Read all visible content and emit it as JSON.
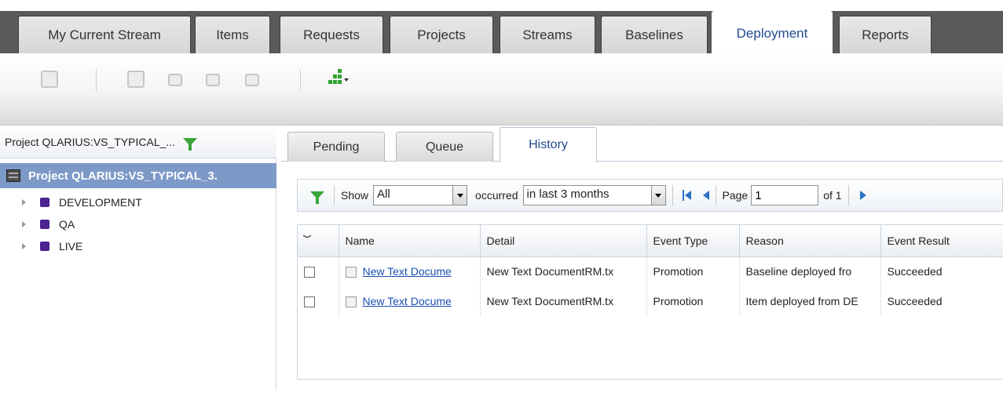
{
  "top_tabs": [
    {
      "label": "My Current Stream",
      "active": false
    },
    {
      "label": "Items",
      "active": false
    },
    {
      "label": "Requests",
      "active": false
    },
    {
      "label": "Projects",
      "active": false
    },
    {
      "label": "Streams",
      "active": false
    },
    {
      "label": "Baselines",
      "active": false
    },
    {
      "label": "Deployment",
      "active": true
    },
    {
      "label": "Reports",
      "active": false
    }
  ],
  "toolbar": {
    "icons": [
      "import-icon",
      "promote-icon",
      "demote-icon",
      "deploy-icon",
      "rollback-icon",
      "chart-icon"
    ]
  },
  "left_panel": {
    "header": "Project QLARIUS:VS_TYPICAL_...",
    "tree_root": "Project QLARIUS:VS_TYPICAL_3.",
    "nodes": [
      {
        "label": "DEVELOPMENT"
      },
      {
        "label": "QA"
      },
      {
        "label": "LIVE"
      }
    ]
  },
  "sub_tabs": [
    {
      "label": "Pending",
      "active": false
    },
    {
      "label": "Queue",
      "active": false
    },
    {
      "label": "History",
      "active": true
    }
  ],
  "filter_bar": {
    "show_label": "Show",
    "show_value": "All",
    "occurred_label": "occurred",
    "occurred_value": "in last 3 months",
    "page_label": "Page",
    "page_value": "1",
    "of_label": "of 1"
  },
  "table": {
    "columns": [
      "Name",
      "Detail",
      "Event Type",
      "Reason",
      "Event Result"
    ],
    "rows": [
      {
        "name": "New Text Docume",
        "detail": "New Text DocumentRM.tx",
        "event_type": "Promotion",
        "reason": "Baseline deployed fro",
        "result": "Succeeded"
      },
      {
        "name": "New Text Docume",
        "detail": "New Text DocumentRM.tx",
        "event_type": "Promotion",
        "reason": "Item deployed from DE",
        "result": "Succeeded"
      }
    ]
  },
  "colors": {
    "top_bar": "#5a5a5a",
    "active_tab_text": "#1f4a8f",
    "tree_selection": "#7d99c8",
    "stream_icon": "#4b2390",
    "link": "#1a4fb2",
    "filter_green": "#3aa53a"
  }
}
